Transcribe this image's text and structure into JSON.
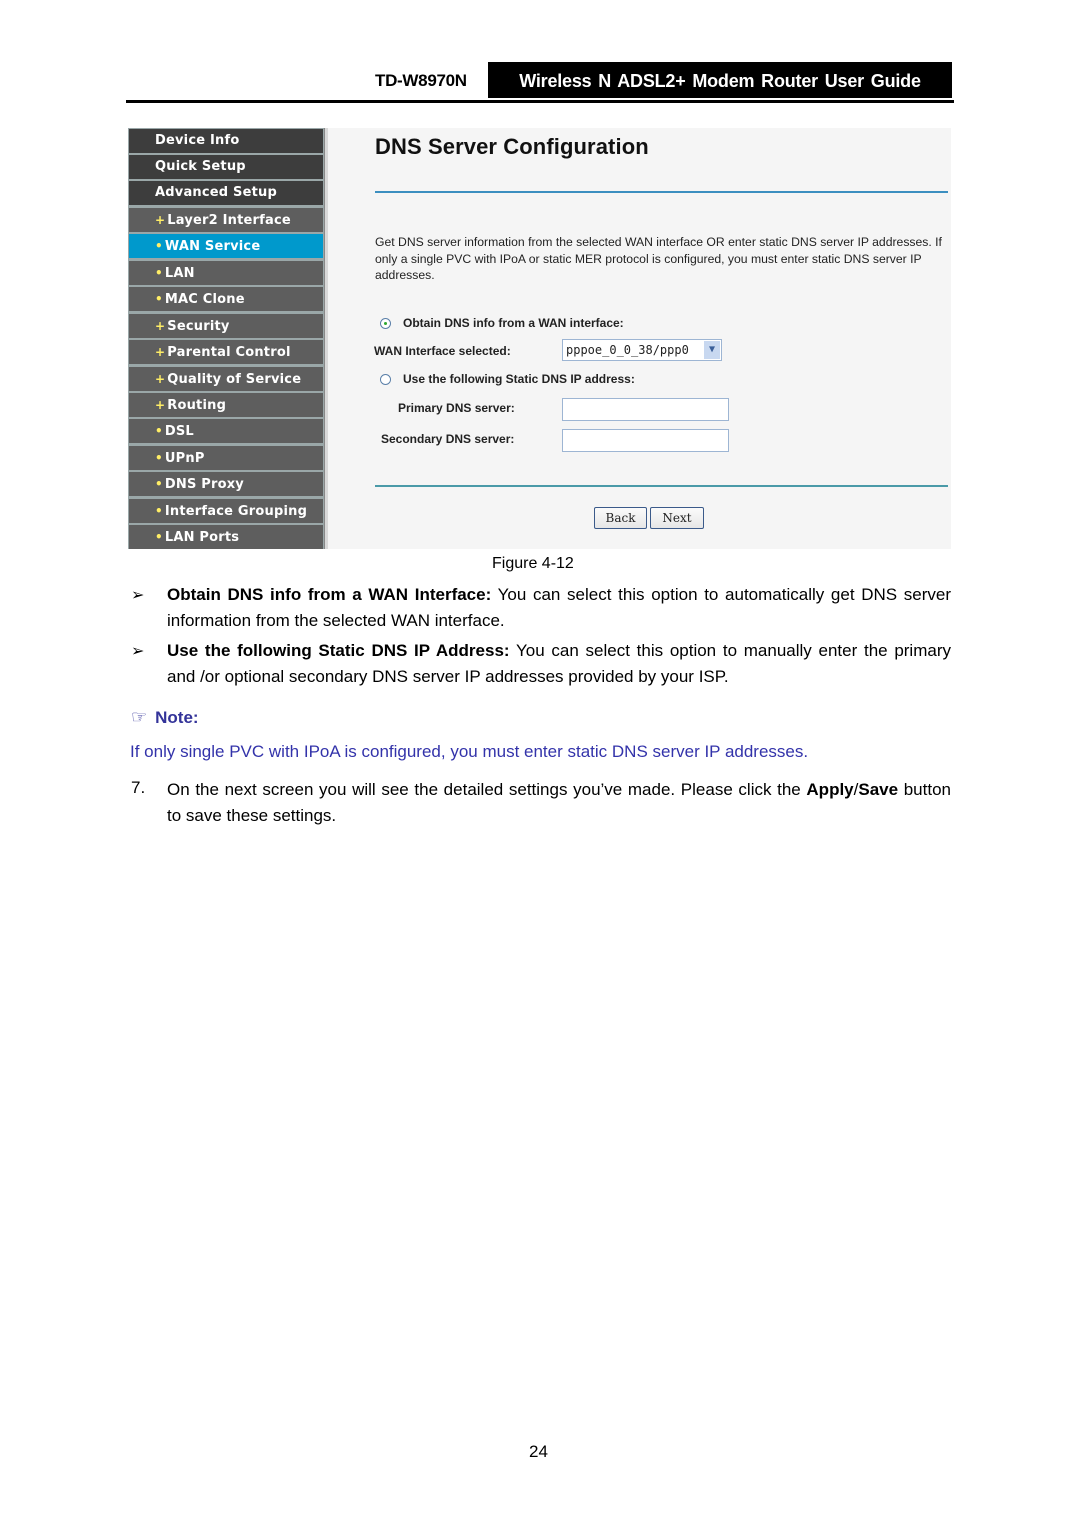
{
  "header": {
    "model": "TD-W8970N",
    "guide_title": "Wireless N ADSL2+ Modem Router User Guide"
  },
  "screenshot": {
    "nav": [
      {
        "label": "Device Info",
        "level": "top",
        "bullet": ""
      },
      {
        "label": "Quick Setup",
        "level": "top",
        "bullet": ""
      },
      {
        "label": "Advanced Setup",
        "level": "top",
        "bullet": ""
      },
      {
        "label": "Layer2 Interface",
        "level": "sub",
        "bullet": "+"
      },
      {
        "label": "WAN Service",
        "level": "sub",
        "bullet": "•",
        "active": true
      },
      {
        "label": "LAN",
        "level": "sub",
        "bullet": "•"
      },
      {
        "label": "MAC Clone",
        "level": "sub",
        "bullet": "•"
      },
      {
        "label": "Security",
        "level": "sub",
        "bullet": "+"
      },
      {
        "label": "Parental Control",
        "level": "sub",
        "bullet": "+"
      },
      {
        "label": "Quality of Service",
        "level": "sub",
        "bullet": "+"
      },
      {
        "label": "Routing",
        "level": "sub",
        "bullet": "+"
      },
      {
        "label": "DSL",
        "level": "sub",
        "bullet": "•"
      },
      {
        "label": "UPnP",
        "level": "sub",
        "bullet": "•"
      },
      {
        "label": "DNS Proxy",
        "level": "sub",
        "bullet": "•"
      },
      {
        "label": "Interface Grouping",
        "level": "sub",
        "bullet": "•"
      },
      {
        "label": "LAN Ports",
        "level": "sub",
        "bullet": "•"
      }
    ],
    "title": "DNS Server Configuration",
    "description": "Get DNS server information from the selected WAN interface OR enter static DNS server IP addresses. If only a single PVC with IPoA or static MER protocol is configured, you must enter static DNS server IP addresses.",
    "option_wan": "Obtain DNS info from a WAN interface:",
    "wan_selected_label": "WAN Interface selected:",
    "wan_selected_value": "pppoe_0_0_38/ppp0",
    "option_static": "Use the following Static DNS IP address:",
    "primary_label": "Primary DNS server:",
    "primary_value": "",
    "secondary_label": "Secondary DNS server:",
    "secondary_value": "",
    "back_button": "Back",
    "next_button": "Next"
  },
  "caption": "Figure 4-12",
  "bullets": [
    {
      "mark": "➢",
      "bold": "Obtain DNS info from a WAN Interface:",
      "text": " You can select this option to automatically get DNS server information from the selected WAN interface."
    },
    {
      "mark": "➢",
      "bold": "Use the following Static DNS IP Address:",
      "text": " You can select this option to manually enter the primary and /or optional secondary DNS server IP addresses provided by your ISP."
    }
  ],
  "note": {
    "icon": "☞",
    "title": "Note:",
    "text": "If only single PVC with IPoA is configured, you must enter static DNS server IP addresses."
  },
  "step": {
    "number": "7.",
    "text_pre": "On the next screen you will see the detailed settings you’ve made. Please click the ",
    "bold1": "Apply",
    "slash": "/",
    "bold2": "Save",
    "text_post": " button to save these settings."
  },
  "page_number": "24"
}
